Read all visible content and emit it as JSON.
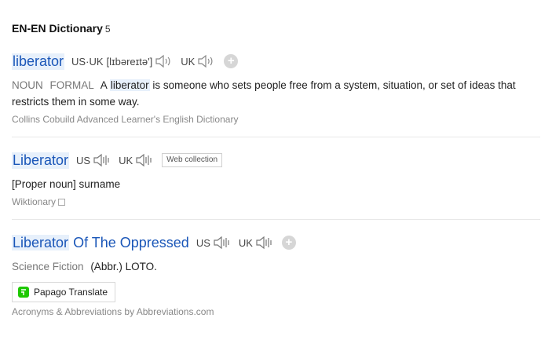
{
  "header": {
    "title": "EN-EN Dictionary",
    "count": "5"
  },
  "entries": [
    {
      "word": "liberator",
      "pron_us_label": "US",
      "pron_uk_inline_label": "UK",
      "ipa": "[lɪbəreɪtə']",
      "pron_uk_label": "UK",
      "pos": "NOUN",
      "register": "FORMAL",
      "def_prefix": "A",
      "def_highlight": "liberator",
      "def_rest": "is someone who sets people free from a system, situation, or set of ideas that restricts them in some way.",
      "source": "Collins Cobuild Advanced Learner's English Dictionary"
    },
    {
      "word": "Liberator",
      "pron_us_label": "US",
      "pron_uk_label": "UK",
      "tag": "Web collection",
      "definition": "[Proper noun] surname",
      "source": "Wiktionary"
    },
    {
      "word_highlight": "Liberator",
      "word_rest": "Of The Oppressed",
      "pron_us_label": "US",
      "pron_uk_label": "UK",
      "category": "Science Fiction",
      "definition": "(Abbr.) LOTO.",
      "button_label": "Papago Translate",
      "source": "Acronyms & Abbreviations by Abbreviations.com"
    }
  ],
  "colors": {
    "link_blue": "#1a56b8",
    "highlight": "#e7f0fb",
    "papago_green": "#1ec800"
  }
}
